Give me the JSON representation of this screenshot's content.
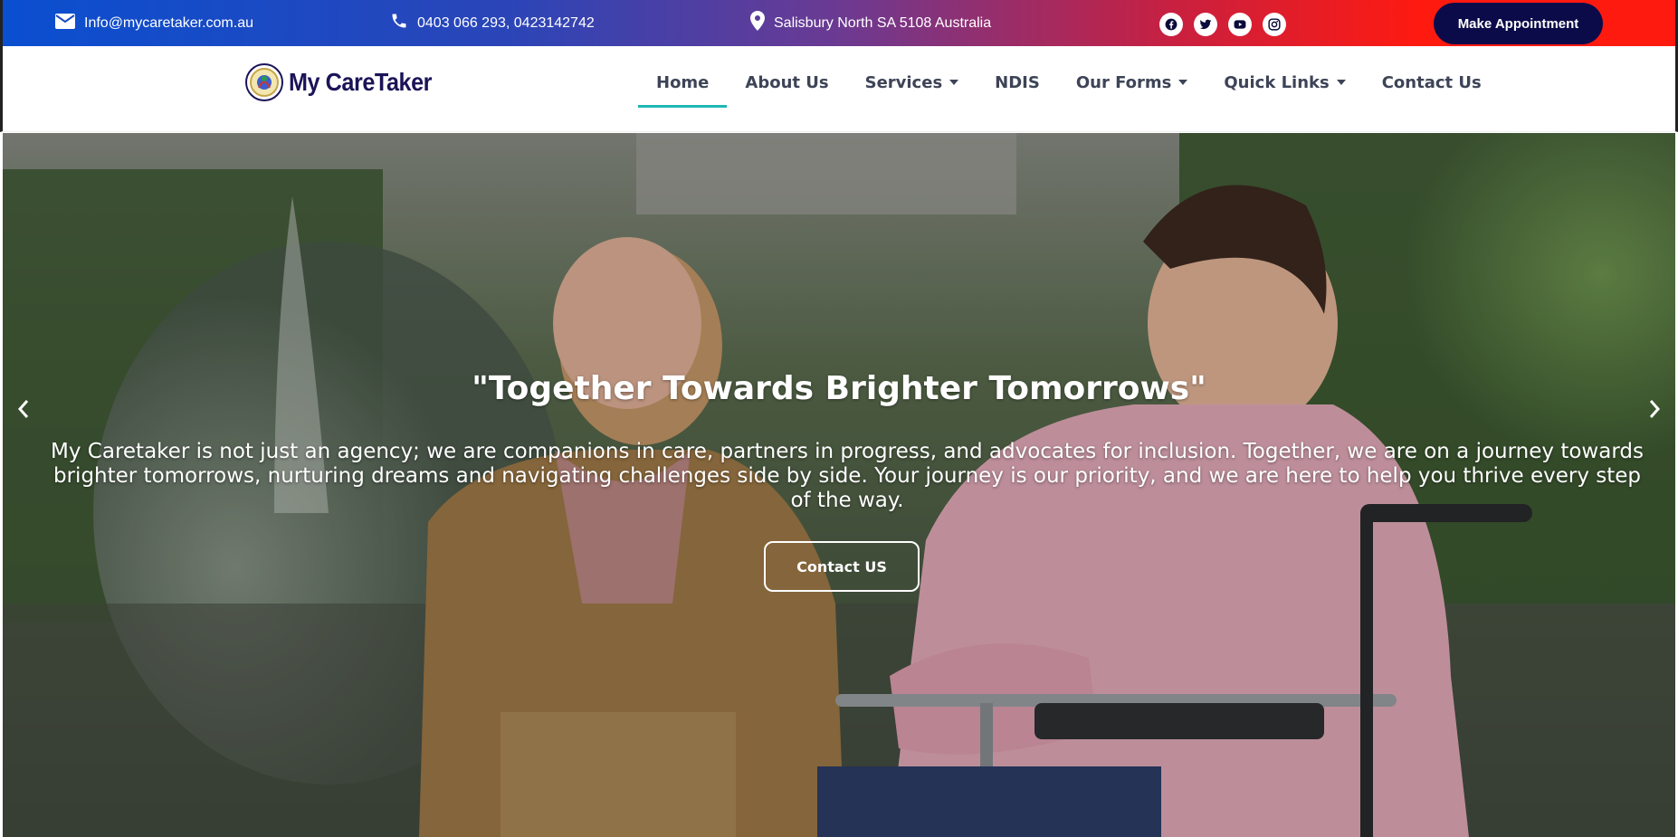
{
  "topbar": {
    "email": "Info@mycaretaker.com.au",
    "phone": "0403 066 293, 0423142742",
    "address": "Salisbury North SA 5108 Australia",
    "social_icons": [
      "facebook-icon",
      "twitter-icon",
      "youtube-icon",
      "instagram-icon"
    ],
    "appointment_label": "Make Appointment"
  },
  "nav": {
    "logo_text": "My CareTaker",
    "items": [
      {
        "label": "Home",
        "active": true,
        "dropdown": false
      },
      {
        "label": "About Us",
        "active": false,
        "dropdown": false
      },
      {
        "label": "Services",
        "active": false,
        "dropdown": true
      },
      {
        "label": "NDIS",
        "active": false,
        "dropdown": false
      },
      {
        "label": "Our Forms",
        "active": false,
        "dropdown": true
      },
      {
        "label": "Quick Links",
        "active": false,
        "dropdown": true
      },
      {
        "label": "Contact Us",
        "active": false,
        "dropdown": false
      }
    ]
  },
  "hero": {
    "title": "\"Together Towards Brighter Tomorrows\"",
    "body": "My Caretaker is not just an agency; we are companions in care, partners in progress, and advocates for inclusion. Together, we are on a journey towards brighter tomorrows, nurturing dreams and navigating challenges side by side. Your journey is our priority, and we are here to help you thrive every step of the way.",
    "cta_label": "Contact US"
  },
  "colors": {
    "topbar_start": "#0a4fd0",
    "topbar_end": "#ff1a10",
    "appointment_bg": "#0b0b4a",
    "active_underline": "#1fb7b5",
    "nav_text": "#3d4457"
  }
}
